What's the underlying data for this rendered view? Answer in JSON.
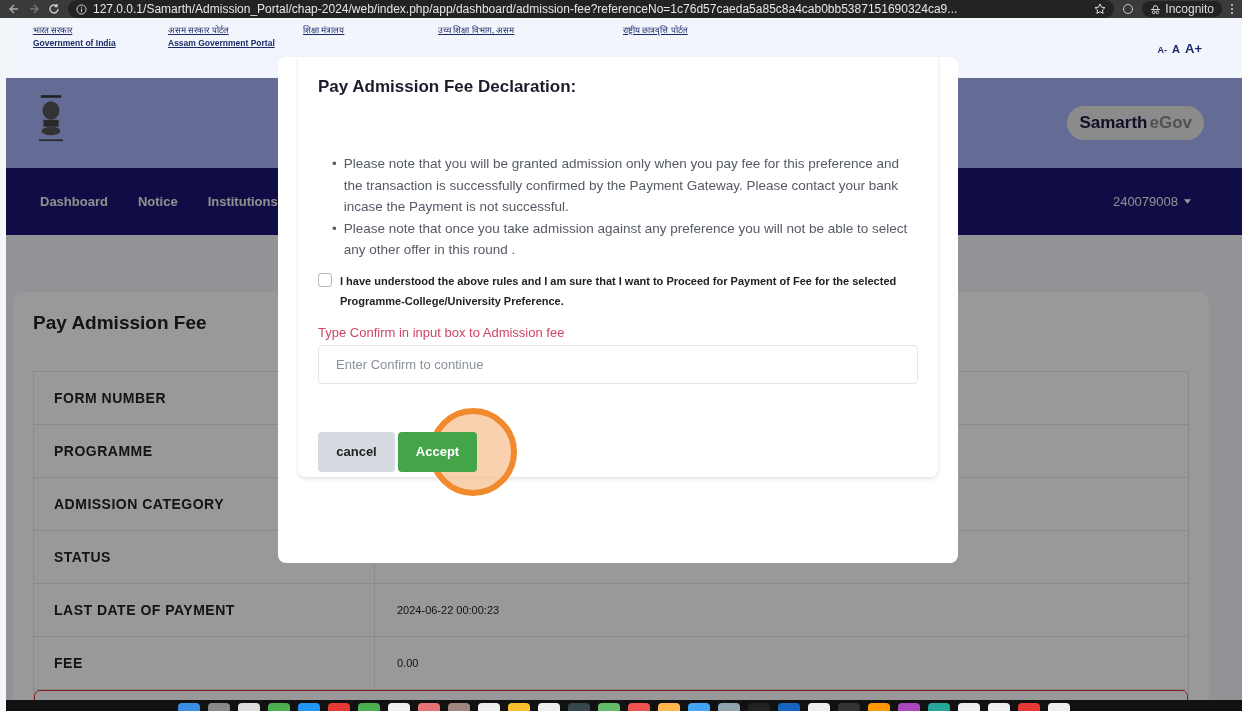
{
  "browser": {
    "url": "127.0.0.1/Samarth/Admission_Portal/chap-2024/web/index.php/app/dashboard/admission-fee?referenceNo=1c76d57caeda5a85c8a4cab0bb5387151690324ca9...",
    "incognito_label": "Incognito"
  },
  "gov_links": [
    {
      "native": "भारत सरकार",
      "english": "Government of India"
    },
    {
      "native": "असम सरकार पोर्टल",
      "english": "Assam Government Portal"
    },
    {
      "native": "शिक्षा मंत्रालय"
    },
    {
      "native": "उच्च शिक्षा विभाग, असम"
    },
    {
      "native": "राष्ट्रीय छात्रवृत्ति पोर्टल"
    }
  ],
  "font_controls": [
    "A-",
    "A",
    "A+"
  ],
  "brand": {
    "name": "Samarth",
    "suffix": "eGov"
  },
  "nav": {
    "items": [
      "Dashboard",
      "Notice",
      "Institutions"
    ],
    "user": "240079008"
  },
  "page": {
    "title": "Pay Admission Fee",
    "rows": [
      {
        "label": "FORM NUMBER"
      },
      {
        "label": "PROGRAMME"
      },
      {
        "label": "ADMISSION CATEGORY"
      },
      {
        "label": "STATUS"
      },
      {
        "label": "LAST DATE OF PAYMENT",
        "value": "2024-06-22 00:00:23"
      },
      {
        "label": "FEE",
        "value": "0.00"
      }
    ]
  },
  "modal": {
    "title": "Pay Admission Fee Declaration:",
    "notes": [
      {
        "marker": "•",
        "text": "Please note that you will be granted admission only when you pay fee for this preference and the transaction is successfully confirmed by the Payment Gateway. Please contact your bank incase the Payment is not successful."
      },
      {
        "marker": "•",
        "text": "Please note that once you take admission against any preference you will not be able to select any other offer in this round ."
      }
    ],
    "agreement": {
      "text": "I have understood the above rules and I am sure that I want to Proceed for Payment of Fee for the selected Programme-College/University Preference.",
      "checked": false
    },
    "confirm": {
      "label": "Type Confirm in input box to Admission fee",
      "placeholder": "Enter Confirm to continue"
    },
    "buttons": {
      "cancel": "cancel",
      "accept": "Accept"
    }
  }
}
